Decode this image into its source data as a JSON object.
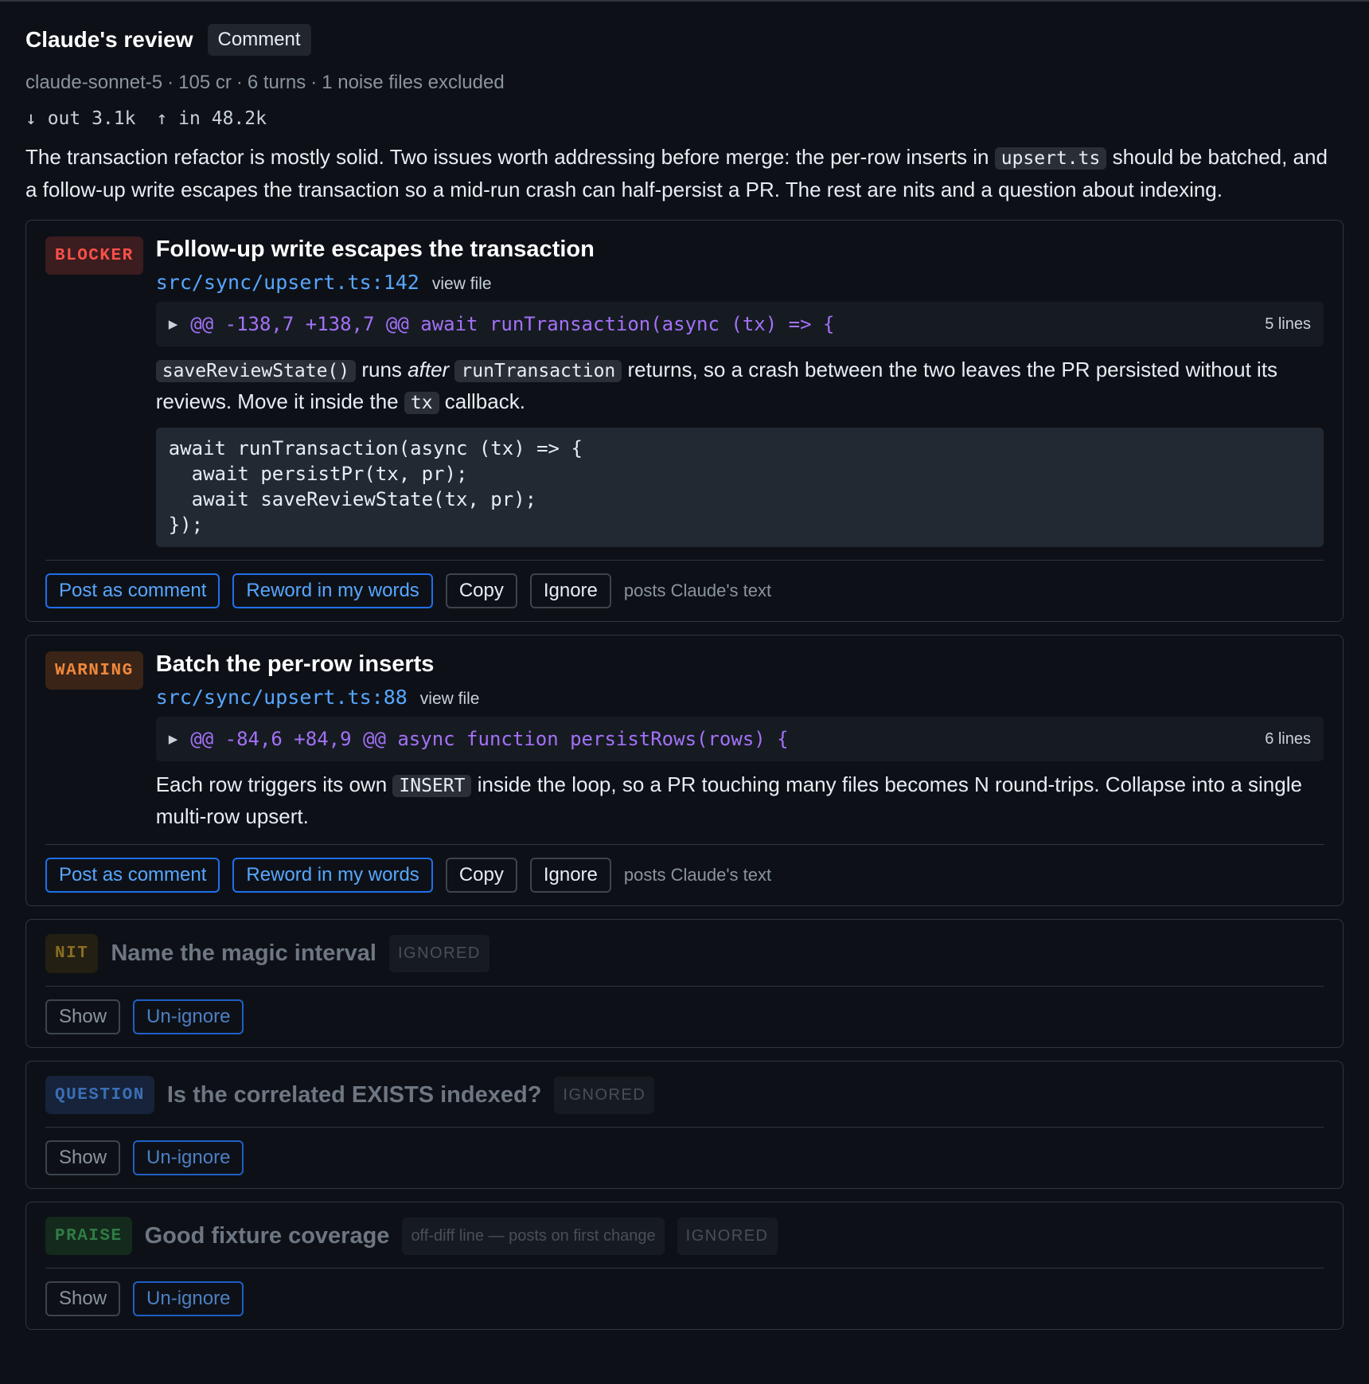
{
  "review": {
    "title": "Claude's review",
    "verdict": "Comment",
    "meta": {
      "model": "claude-sonnet-5",
      "credits": "105 cr",
      "turns": "6 turns",
      "excluded": "1 noise files excluded",
      "separator": "·"
    },
    "tokens": {
      "out": "↓ out 3.1k",
      "in": "↑ in 48.2k"
    },
    "summary": {
      "part1": "The transaction refactor is mostly solid. Two issues worth addressing before merge: the per-row inserts in ",
      "code1": "upsert.ts",
      "part2": " should be batched, and a follow-up write escapes the transaction so a mid-run crash can half-persist a PR. The rest are nits and a question about indexing."
    }
  },
  "labels": {
    "post_as_comment": "Post as comment",
    "reword": "Reword in my words",
    "copy": "Copy",
    "ignore": "Ignore",
    "posts_hint": "posts Claude's text",
    "view_file": "view file",
    "show": "Show",
    "unignore": "Un-ignore",
    "ignored_tag": "IGNORED"
  },
  "findings": [
    {
      "severity": "BLOCKER",
      "title": "Follow-up write escapes the transaction",
      "location": "src/sync/upsert.ts:142",
      "hunk": "@@ -138,7 +138,7 @@ await runTransaction(async (tx) => {",
      "hunk_lines": "5 lines",
      "body": {
        "code1": "saveReviewState()",
        "t1": " runs ",
        "em": "after",
        "t2": " ",
        "code2": "runTransaction",
        "t3": " returns, so a crash between the two leaves the PR persisted without its reviews. Move it inside the ",
        "code3": "tx",
        "t4": " callback."
      },
      "suggestion": "await runTransaction(async (tx) => {\n  await persistPr(tx, pr);\n  await saveReviewState(tx, pr);\n});"
    },
    {
      "severity": "WARNING",
      "title": "Batch the per-row inserts",
      "location": "src/sync/upsert.ts:88",
      "hunk": "@@ -84,6 +84,9 @@ async function persistRows(rows) {",
      "hunk_lines": "6 lines",
      "body": {
        "t1": "Each row triggers its own ",
        "code1": "INSERT",
        "t2": " inside the loop, so a PR touching many files becomes N round-trips. Collapse into a single multi-row upsert."
      }
    },
    {
      "severity": "NIT",
      "title": "Name the magic interval",
      "status": "IGNORED"
    },
    {
      "severity": "QUESTION",
      "title": "Is the correlated EXISTS indexed?",
      "status": "IGNORED"
    },
    {
      "severity": "PRAISE",
      "title": "Good fixture coverage",
      "note": "off-diff line — posts on first change",
      "status": "IGNORED"
    }
  ],
  "colors": {
    "background": "#0d1117",
    "blocker": "#f85149",
    "warning": "#f0883e",
    "nit": "#8a6d22",
    "question": "#3b6fb6",
    "praise": "#2f7d45",
    "link": "#58a6ff",
    "hunk": "#a371f7"
  }
}
